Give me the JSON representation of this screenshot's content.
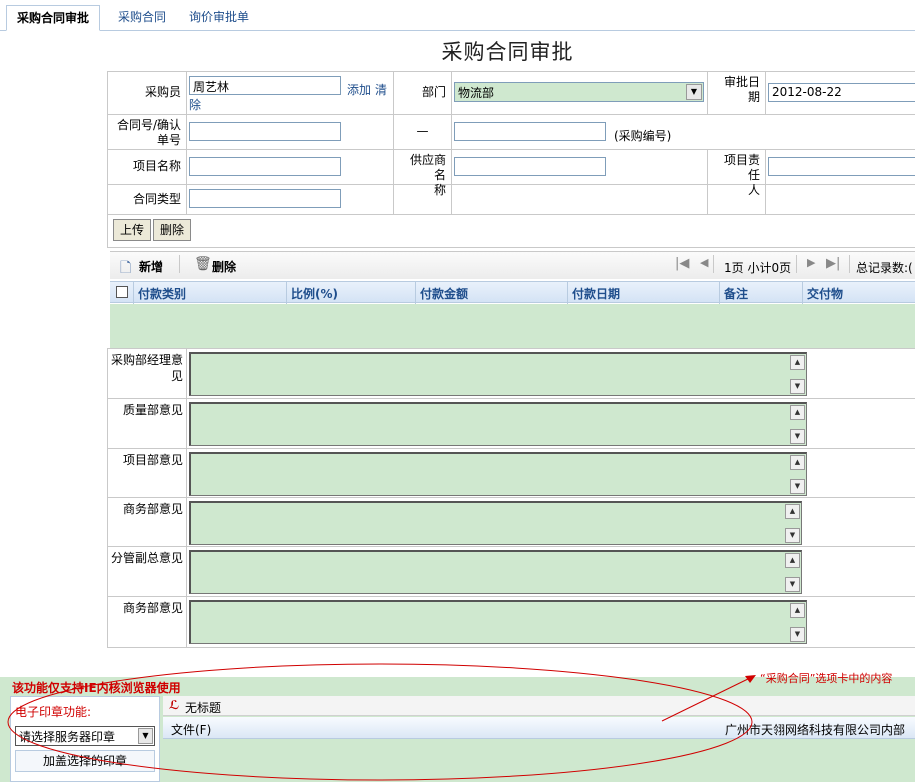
{
  "tabs": [
    {
      "label": "采购合同审批",
      "active": true
    },
    {
      "label": "采购合同",
      "active": false
    },
    {
      "label": "询价审批单",
      "active": false
    }
  ],
  "page_title": "采购合同审批",
  "form": {
    "buyer_label": "采购员",
    "buyer_value": "周艺林",
    "add_link": "添加",
    "clear_link": "清",
    "clear_link_tail": "除",
    "dept_label": "部门",
    "dept_value": "物流部",
    "approve_date_label_1": "审批日",
    "approve_date_label_2": "期",
    "approve_date_value": "2012-08-22",
    "contract_no_label_1": "合同号/确认",
    "contract_no_label_2": "单号",
    "dash": "—",
    "purchase_no_hint": "(采购编号)",
    "project_name_label": "项目名称",
    "supplier_label_1": "供应商名",
    "supplier_label_2": "称",
    "project_owner_label_1": "项目责任",
    "project_owner_label_2": "人",
    "contract_type_label": "合同类型"
  },
  "buttons": {
    "upload": "上传",
    "delete": "删除"
  },
  "grid": {
    "add_label": "新增",
    "delete_label": "删除",
    "page_info": "1页 小计0页",
    "total_label": "总记录数:(",
    "columns": [
      "付款类别",
      "比例(%)",
      "付款金额",
      "付款日期",
      "备注",
      "交付物"
    ]
  },
  "opinions": [
    {
      "label": "采购部经理意见"
    },
    {
      "label": "质量部意见"
    },
    {
      "label": "项目部意见"
    },
    {
      "label": "商务部意见"
    },
    {
      "label": "分管副总意见"
    },
    {
      "label": "商务部意见"
    }
  ],
  "bottom": {
    "warning": "该功能仅支持IE内核浏览器使用",
    "seal_label": "电子印章功能:",
    "seal_select": "请选择服务器印章",
    "seal_button": "加盖选择的印章",
    "doc_title": "无标题",
    "file_menu": "文件(F)",
    "company": "广州市天翎网络科技有限公司内部",
    "annotation": "“采购合同”选项卡中的内容"
  },
  "colors": {
    "field_green": "#cfe8cf",
    "annotation_red": "#d00000",
    "link_blue": "#1f4e8c"
  }
}
